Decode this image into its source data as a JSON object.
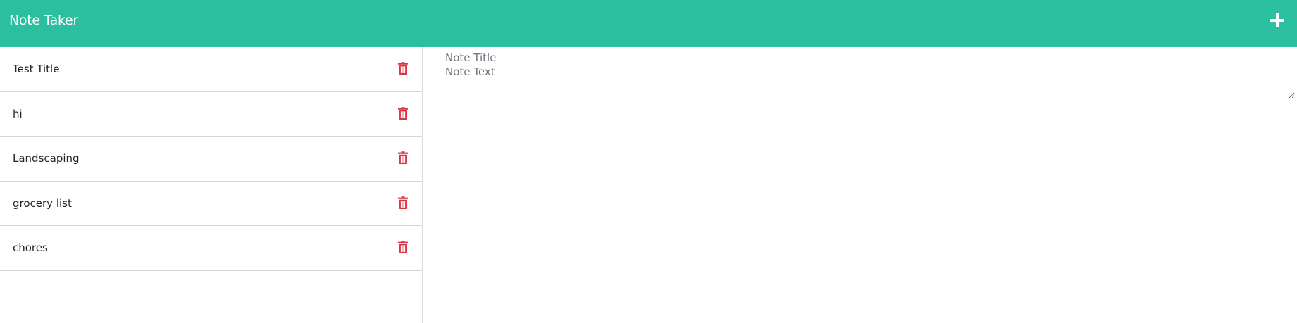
{
  "app": {
    "title": "Note Taker",
    "accent_color": "#2bbf9f",
    "delete_color": "#dc3545"
  },
  "header": {
    "new_note_icon": "plus-icon"
  },
  "notes": [
    {
      "title": "Test Title",
      "icon": "trash-icon"
    },
    {
      "title": "hi",
      "icon": "trash-icon"
    },
    {
      "title": "Landscaping",
      "icon": "trash-icon"
    },
    {
      "title": "grocery list",
      "icon": "trash-icon"
    },
    {
      "title": "chores",
      "icon": "trash-icon"
    }
  ],
  "editor": {
    "title_placeholder": "Note Title",
    "title_value": "",
    "text_placeholder": "Note Text",
    "text_value": ""
  }
}
